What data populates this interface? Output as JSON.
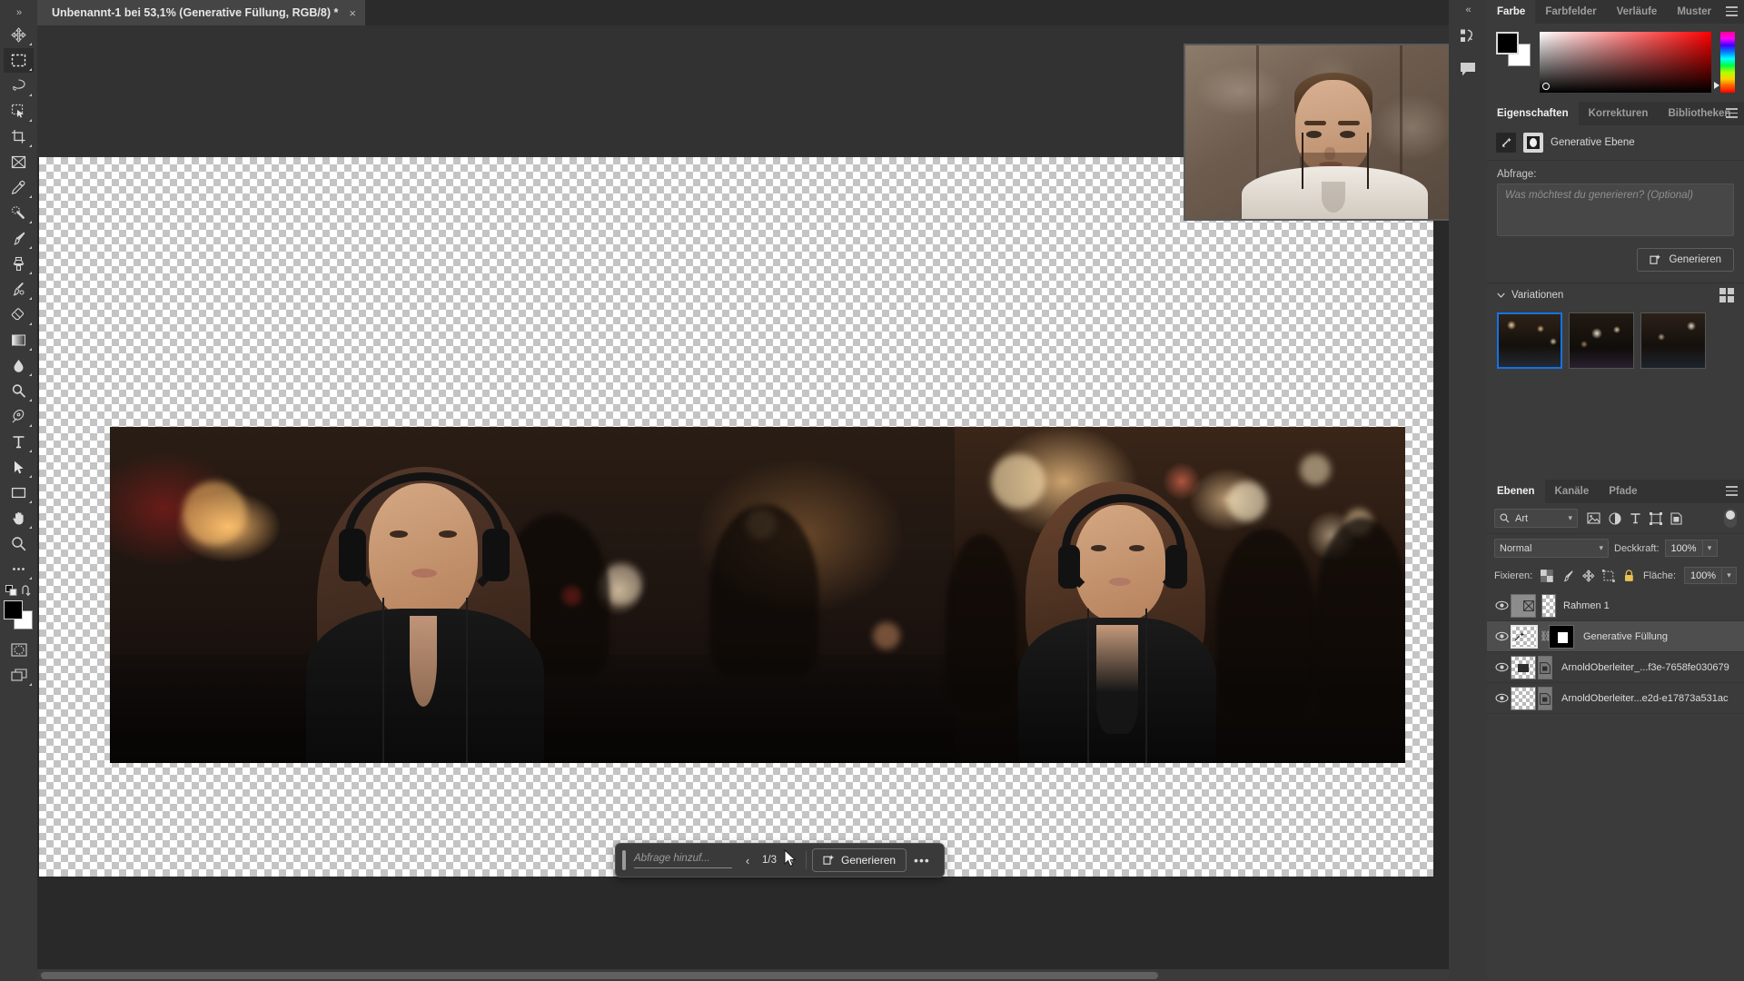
{
  "app": {
    "document_tab": {
      "title": "Unbenannt-1 bei 53,1% (Generative Füllung, RGB/8) *",
      "close_label": "×"
    },
    "collapse_label": "»",
    "dock_collapse_label": "«"
  },
  "toolbar": {
    "tools": [
      {
        "name": "move-tool",
        "label": "Verschieben-Werkzeug"
      },
      {
        "name": "rectangular-marquee-tool",
        "label": "Auswahlrechteck-Werkzeug"
      },
      {
        "name": "lasso-tool",
        "label": "Lasso-Werkzeug"
      },
      {
        "name": "quick-selection-tool",
        "label": "Schnellauswahl-Werkzeug"
      },
      {
        "name": "crop-tool",
        "label": "Freistellungswerkzeug"
      },
      {
        "name": "frame-tool",
        "label": "Rahmen-Werkzeug"
      },
      {
        "name": "eyedropper-tool",
        "label": "Pipette"
      },
      {
        "name": "spot-healing-brush-tool",
        "label": "Bereichsreparatur-Pinsel"
      },
      {
        "name": "brush-tool",
        "label": "Pinsel-Werkzeug"
      },
      {
        "name": "clone-stamp-tool",
        "label": "Kopierstempel"
      },
      {
        "name": "history-brush-tool",
        "label": "Protokollpinsel"
      },
      {
        "name": "eraser-tool",
        "label": "Radiergummi"
      },
      {
        "name": "gradient-tool",
        "label": "Verlaufswerkzeug"
      },
      {
        "name": "blur-tool",
        "label": "Weichzeichner"
      },
      {
        "name": "dodge-tool",
        "label": "Abwedler"
      },
      {
        "name": "pen-tool",
        "label": "Zeichenstift-Werkzeug"
      },
      {
        "name": "type-tool",
        "label": "Text-Werkzeug"
      },
      {
        "name": "path-selection-tool",
        "label": "Pfadauswahl-Werkzeug"
      },
      {
        "name": "rectangle-tool",
        "label": "Rechteck-Werkzeug"
      },
      {
        "name": "hand-tool",
        "label": "Hand-Werkzeug"
      },
      {
        "name": "zoom-tool",
        "label": "Zoom-Werkzeug"
      },
      {
        "name": "more-tools",
        "label": "Werkzeuge bearbeiten"
      }
    ],
    "active_tool_index": 1,
    "foreground_color": "#000000",
    "background_color": "#ffffff"
  },
  "canvas": {
    "zoom_level": "53,1%",
    "taskbar": {
      "prompt_placeholder": "Abfrage hinzuf...",
      "prev_label": "‹",
      "next_label": "›",
      "counter": "1/3",
      "generate_label": "Generieren",
      "more_label": "•••"
    }
  },
  "color_panel": {
    "tabs": [
      {
        "label": "Farbe",
        "active": true
      },
      {
        "label": "Farbfelder",
        "active": false
      },
      {
        "label": "Verläufe",
        "active": false
      },
      {
        "label": "Muster",
        "active": false
      }
    ],
    "foreground_color": "#000000",
    "background_color": "#ffffff",
    "field_hue": "#ff0000"
  },
  "properties_panel": {
    "tabs": [
      {
        "label": "Eigenschaften",
        "active": true
      },
      {
        "label": "Korrekturen",
        "active": false
      },
      {
        "label": "Bibliotheken",
        "active": false
      }
    ],
    "layer_type": "Generative Ebene",
    "prompt_label": "Abfrage:",
    "prompt_placeholder": "Was möchtest du generieren?  (Optional)",
    "prompt_value": "",
    "generate_label": "Generieren",
    "variations_label": "Variationen",
    "variations": [
      {
        "name": "variation-1",
        "selected": true
      },
      {
        "name": "variation-2",
        "selected": false
      },
      {
        "name": "variation-3",
        "selected": false
      }
    ],
    "selection_accent": "#1473e6"
  },
  "layers_panel": {
    "tabs": [
      {
        "label": "Ebenen",
        "active": true
      },
      {
        "label": "Kanäle",
        "active": false
      },
      {
        "label": "Pfade",
        "active": false
      }
    ],
    "filter_type": "Art",
    "blend_mode": "Normal",
    "opacity_label": "Deckkraft:",
    "opacity_value": "100%",
    "lock_label": "Fixieren:",
    "fill_label": "Fläche:",
    "fill_value": "100%",
    "layers": [
      {
        "name": "Rahmen 1",
        "visible": true,
        "selected": false,
        "kind": "frame"
      },
      {
        "name": "Generative Füllung",
        "visible": true,
        "selected": true,
        "kind": "generative"
      },
      {
        "name": "ArnoldOberleiter_...f3e-7658fe030679",
        "visible": true,
        "selected": false,
        "kind": "smart"
      },
      {
        "name": "ArnoldOberleiter...e2d-e17873a531ac",
        "visible": true,
        "selected": false,
        "kind": "smart"
      }
    ]
  }
}
